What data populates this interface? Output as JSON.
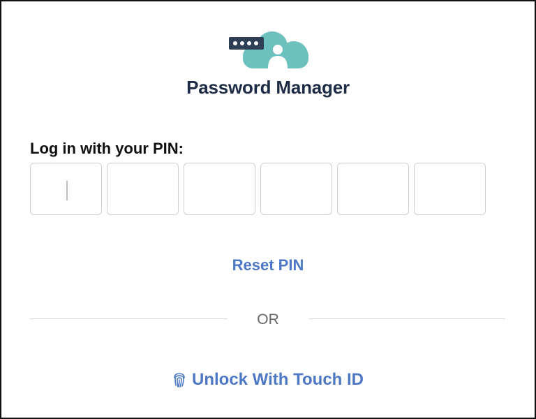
{
  "app": {
    "title": "Password Manager"
  },
  "login": {
    "pin_label": "Log in with your PIN:",
    "pin_digits": [
      "",
      "",
      "",
      "",
      "",
      ""
    ],
    "reset_label": "Reset PIN",
    "or_label": "OR",
    "touchid_label": "Unlock With Touch ID"
  },
  "colors": {
    "brand_teal": "#6cc0bd",
    "title_navy": "#1d2b45",
    "link_blue": "#4e78c4",
    "dots_panel": "#2d3e55"
  },
  "icons": {
    "logo": "cloud-password-icon",
    "touchid": "fingerprint-icon"
  }
}
